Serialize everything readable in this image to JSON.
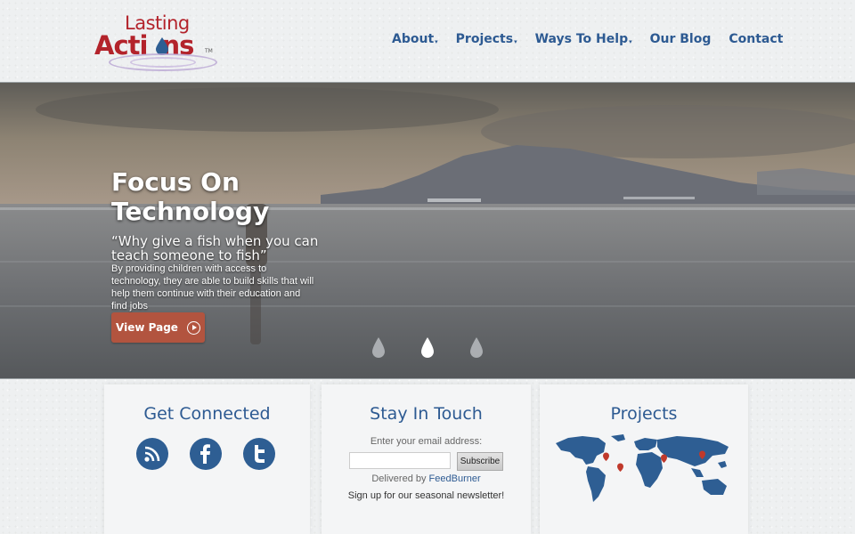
{
  "logo": {
    "line1": "Lasting",
    "line2_a": "Acti",
    "line2_b": "ns",
    "tm": "TM"
  },
  "nav": [
    {
      "label": "About",
      "has_dropdown": true
    },
    {
      "label": "Projects",
      "has_dropdown": true
    },
    {
      "label": "Ways To Help",
      "has_dropdown": true
    },
    {
      "label": "Our Blog",
      "has_dropdown": false
    },
    {
      "label": "Contact",
      "has_dropdown": false
    }
  ],
  "hero": {
    "title": "Focus On Technology",
    "quote": "“Why give a fish when you can teach someone to fish”",
    "description": "By providing children with access to technology, they are able to build skills that will help them continue with their education and find jobs",
    "button_label": "View Page",
    "slides": 3,
    "active_slide": 2
  },
  "panels": {
    "connected": {
      "title": "Get Connected",
      "icons": [
        "rss-icon",
        "facebook-icon",
        "twitter-icon"
      ]
    },
    "touch": {
      "title": "Stay In Touch",
      "email_label": "Enter your email address:",
      "email_value": "",
      "subscribe_label": "Subscribe",
      "delivered_prefix": "Delivered by ",
      "delivered_link": "FeedBurner",
      "newsletter_text": "Sign up for our seasonal newsletter!"
    },
    "projects": {
      "title": "Projects"
    }
  },
  "colors": {
    "brand_red": "#b3232b",
    "nav_blue": "#2d5a92",
    "button": "#b2543f"
  }
}
